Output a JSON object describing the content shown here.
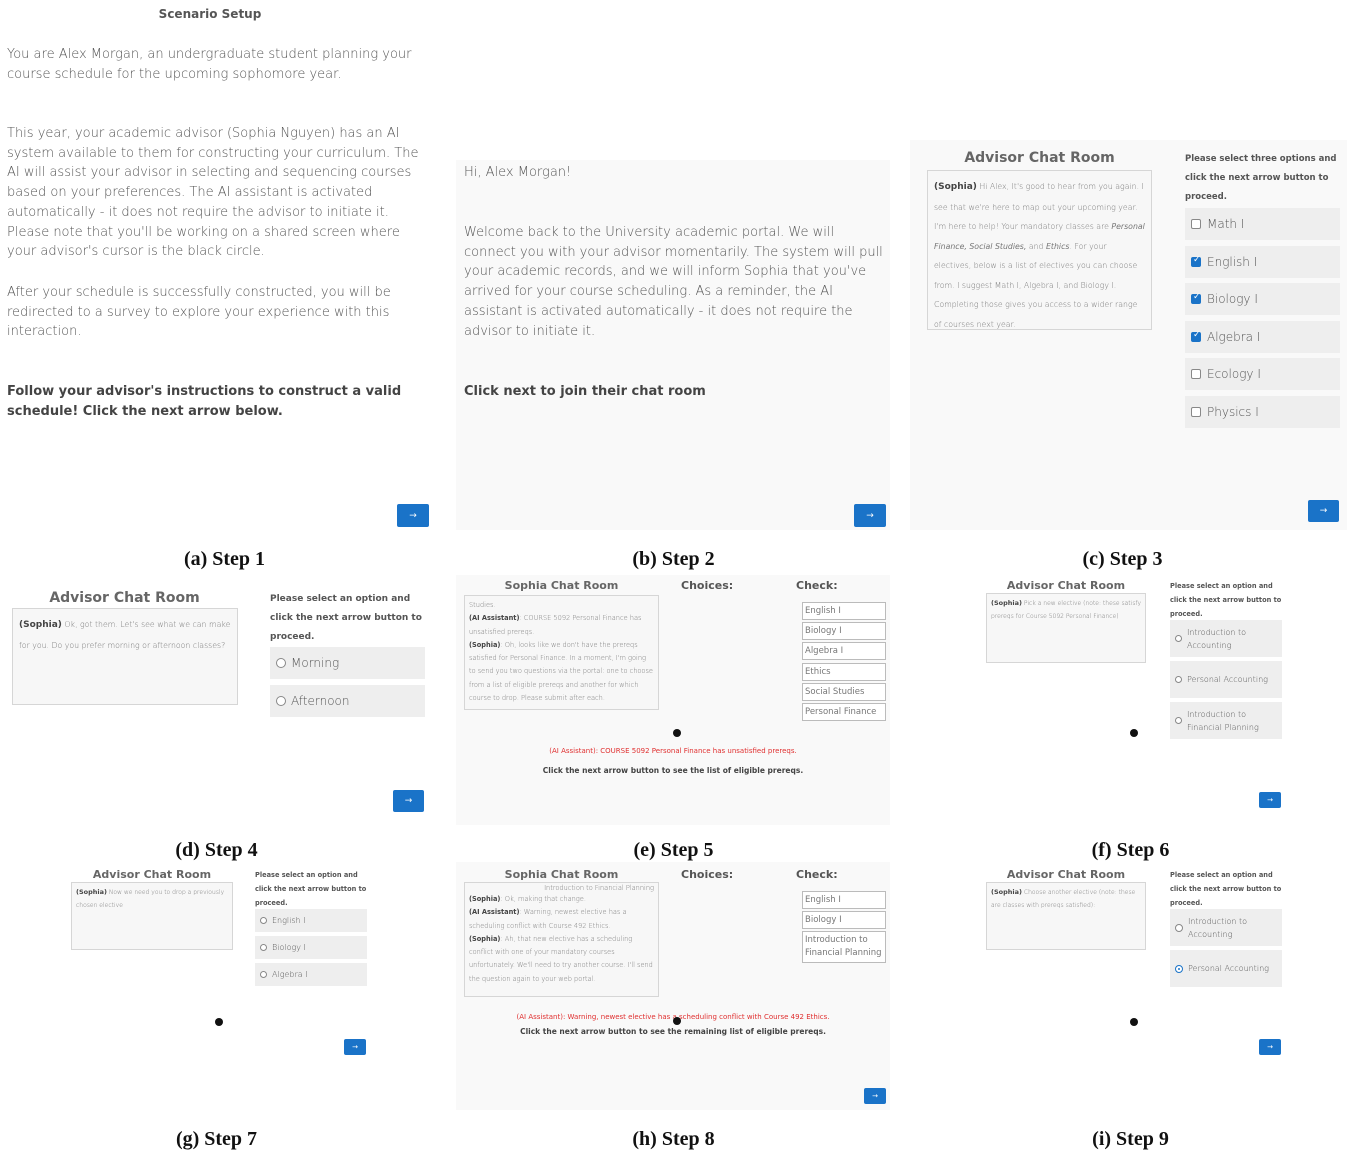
{
  "captions": [
    "(a) Step 1",
    "(b) Step 2",
    "(c) Step 3",
    "(d) Step 4",
    "(e) Step 5",
    "(f) Step 6",
    "(g) Step 7",
    "(h) Step 8",
    "(i) Step 9"
  ],
  "next_label": "→",
  "step1": {
    "title": "Scenario Setup",
    "p1": "You are Alex Morgan, an undergraduate student planning your course schedule for the upcoming sophomore year.",
    "p2": "This year, your academic advisor (Sophia Nguyen) has an AI system available to them for constructing your curriculum. The AI will assist your advisor in selecting and sequencing courses based on your preferences. The AI assistant is activated automatically - it does not require the advisor to initiate it. Please note that you'll be working on a shared screen where your advisor's cursor is the black circle.",
    "p3": "After your schedule is successfully constructed, you will be redirected to a survey to explore your experience with this interaction.",
    "p4": "Follow your advisor's instructions to construct a valid schedule! Click the next arrow below."
  },
  "step2": {
    "greeting": "Hi, Alex Morgan!",
    "p1": "Welcome back to the University academic portal. We will connect you with your advisor momentarily. The system will pull your academic records, and we will inform Sophia that you've arrived for your course scheduling. As a reminder, the AI assistant is activated automatically - it does not require the advisor to initiate it.",
    "p2": "Click next to join their chat room"
  },
  "step3": {
    "chat_title": "Advisor Chat Room",
    "speaker": "(Sophia)",
    "msg_a": " Hi Alex, It's good to hear from you again. I see that we're here to map out your upcoming year. I'm here to help! Your mandatory classes are ",
    "msg_italic": "Personal Finance, Social Studies,",
    "msg_b": " and ",
    "msg_italic2": "Ethics",
    "msg_c": ". For your electives, below is a list of electives you can choose from. I suggest Math I, Algebra I, and Biology I. Completing those gives you access to a wider range of courses next year.",
    "instruction": "Please select three options and click the next arrow button to proceed.",
    "options": [
      {
        "label": "Math I",
        "checked": false
      },
      {
        "label": "English I",
        "checked": true
      },
      {
        "label": "Biology I",
        "checked": true
      },
      {
        "label": "Algebra I",
        "checked": true
      },
      {
        "label": "Ecology I",
        "checked": false
      },
      {
        "label": "Physics I",
        "checked": false
      }
    ]
  },
  "step4": {
    "chat_title": "Advisor Chat Room",
    "speaker": "(Sophia)",
    "msg": " Ok, got them. Let's see what we can make for you. Do you prefer morning or afternoon classes?",
    "instruction": "Please select an option and click the next arrow button to proceed.",
    "options": [
      "Morning",
      "Afternoon"
    ]
  },
  "step5": {
    "chat_title": "Sophia Chat Room",
    "choices_head": "Choices:",
    "check_head": "Check:",
    "lines": [
      {
        "speaker": "",
        "text": "Studies."
      },
      {
        "speaker": "(AI Assistant)",
        "text": ": COURSE 5092 Personal Finance has unsatisfied prereqs."
      },
      {
        "speaker": "(Sophia)",
        "text": ": Oh, looks like we don't have the prereqs satisfied for Personal Finance. In a moment, I'm going to send you two questions via the portal: one to choose from a list of eligible prereqs and another for which course to drop. Please submit after each."
      }
    ],
    "check": [
      "English I",
      "Biology I",
      "Algebra I",
      "Ethics",
      "Social Studies",
      "Personal Finance"
    ],
    "red": "(AI Assistant): COURSE 5092 Personal Finance has unsatisfied prereqs.",
    "bold": "Click the next arrow button to see the list of eligible prereqs."
  },
  "step6": {
    "chat_title": "Advisor Chat Room",
    "speaker": "(Sophia)",
    "msg": " Pick a new elective (note: these satisfy prereqs for Course 5092 Personal Finance)",
    "instruction": "Please select an option and click the next arrow button to proceed.",
    "options": [
      "Introduction to Accounting",
      "Personal Accounting",
      "Introduction to Financial Planning"
    ]
  },
  "step7": {
    "chat_title": "Advisor Chat Room",
    "speaker": "(Sophia)",
    "msg": " Now we need you to drop a previously chosen elective",
    "instruction": "Please select an option and click the next arrow button to proceed.",
    "options": [
      "English I",
      "Biology I",
      "Algebra I"
    ]
  },
  "step8": {
    "chat_title": "Sophia Chat Room",
    "choices_head": "Choices:",
    "check_head": "Check:",
    "top_line": "Introduction to Financial Planning",
    "lines": [
      {
        "speaker": "(Sophia)",
        "text": ": Ok, making that change."
      },
      {
        "speaker": "(AI Assistant)",
        "text": ": Warning, newest elective has a scheduling conflict with Course 492 Ethics."
      },
      {
        "speaker": "(Sophia)",
        "text": ": Ah, that new elective has a scheduling conflict with one of your mandatory courses unfortunately. We'll need to try another course. I'll send the question again to your web portal."
      }
    ],
    "check": [
      "English I",
      "Biology I",
      "Introduction to Financial Planning"
    ],
    "red": "(AI Assistant): Warning, newest elective has a scheduling conflict with Course 492 Ethics.",
    "bold": "Click the next arrow button to see the remaining list of eligible prereqs."
  },
  "step9": {
    "chat_title": "Advisor Chat Room",
    "speaker": "(Sophia)",
    "msg": " Choose another elective (note: these are classes with prereqs satisfied):",
    "instruction": "Please select an option and click the next arrow button to proceed.",
    "options": [
      {
        "label": "Introduction to Accounting",
        "selected": false
      },
      {
        "label": "Personal Accounting",
        "selected": true
      }
    ]
  }
}
